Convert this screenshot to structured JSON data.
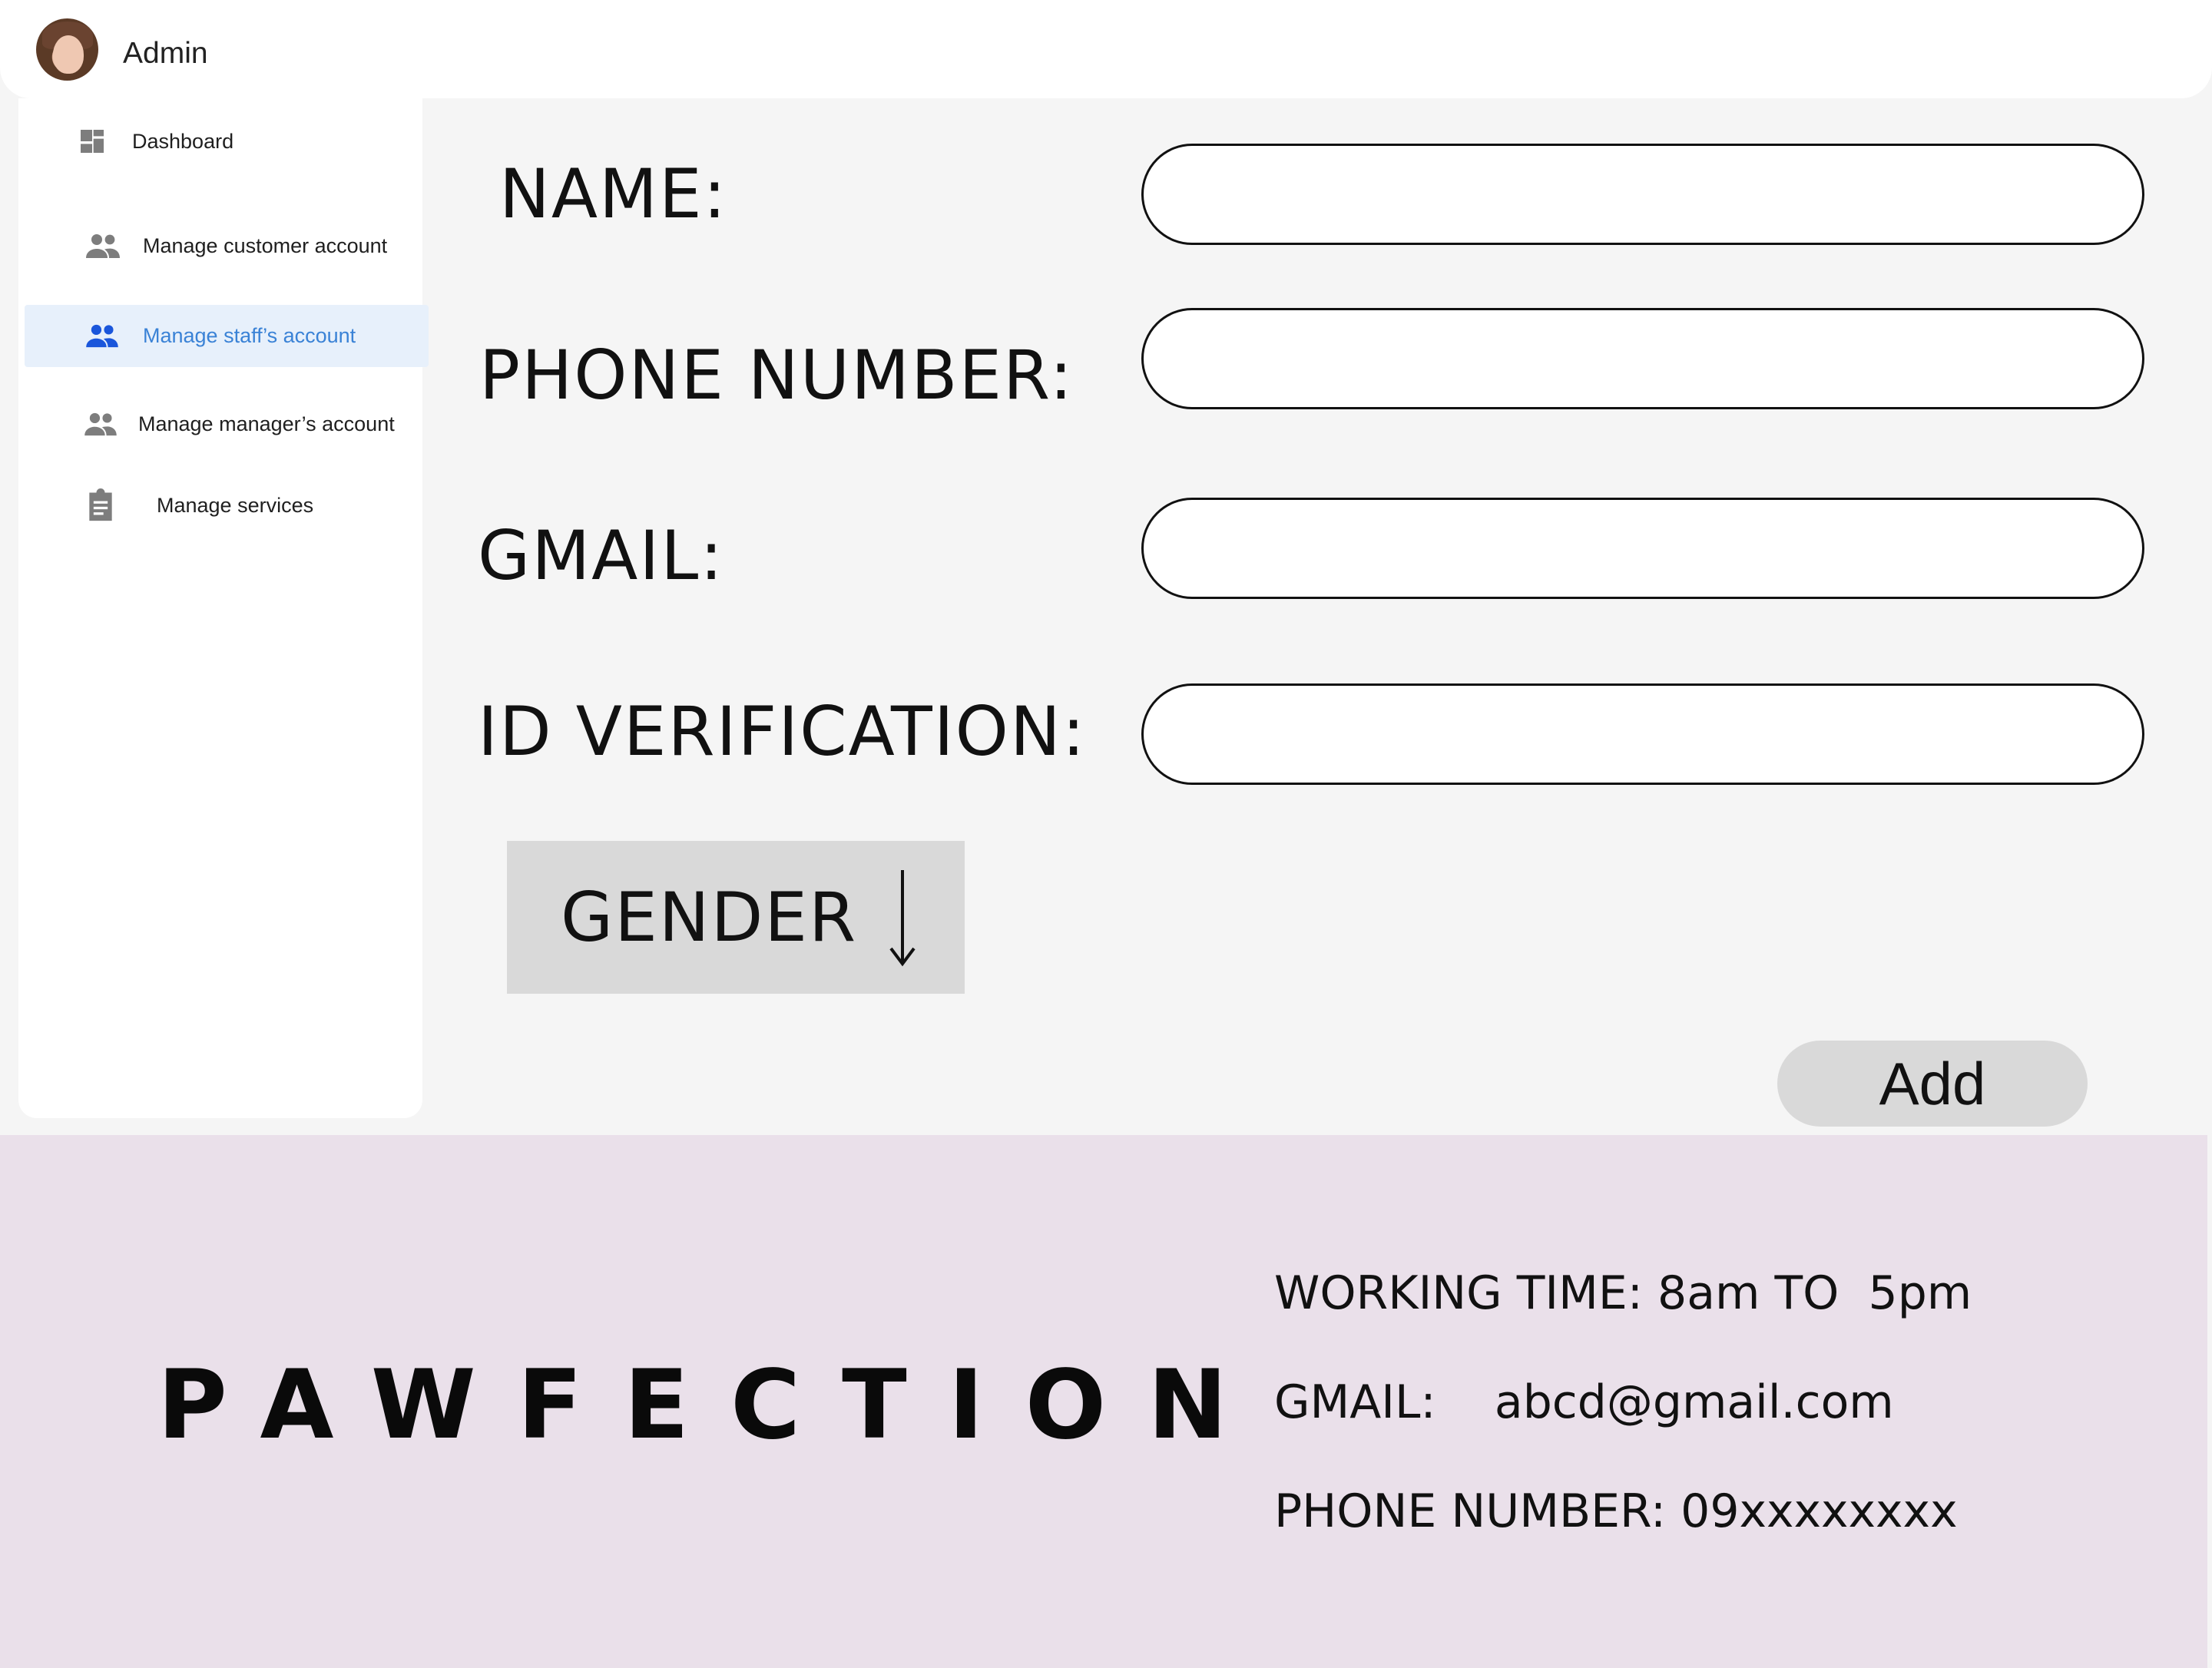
{
  "header": {
    "user_name": "Admin"
  },
  "sidebar": {
    "items": [
      {
        "label": "Dashboard",
        "icon": "dashboard-icon"
      },
      {
        "label": "Manage customer account",
        "icon": "people-icon"
      },
      {
        "label": "Manage staff’s account",
        "icon": "people-icon",
        "active": true
      },
      {
        "label": "Manage manager’s account",
        "icon": "people-icon"
      },
      {
        "label": "Manage services",
        "icon": "clipboard-icon"
      }
    ]
  },
  "form": {
    "name_label": "NAME:",
    "phone_label": "PHONE NUMBER:",
    "gmail_label": "GMAIL:",
    "id_label": "ID VERIFICATION:",
    "name_value": "",
    "phone_value": "",
    "gmail_value": "",
    "id_value": "",
    "gender_label": "GENDER",
    "add_label": "Add"
  },
  "footer": {
    "brand": "PAWFECTION",
    "working_time": "WORKING TIME: 8am TO  5pm",
    "gmail": "GMAIL:    abcd@gmail.com",
    "phone": "PHONE NUMBER: 09xxxxxxxx"
  },
  "colors": {
    "active_nav_bg": "#e7f0fb",
    "active_nav_text": "#3a82d6",
    "active_icon": "#1a56db",
    "footer_bg": "#eae0ea",
    "button_bg": "#d9d9d9"
  }
}
